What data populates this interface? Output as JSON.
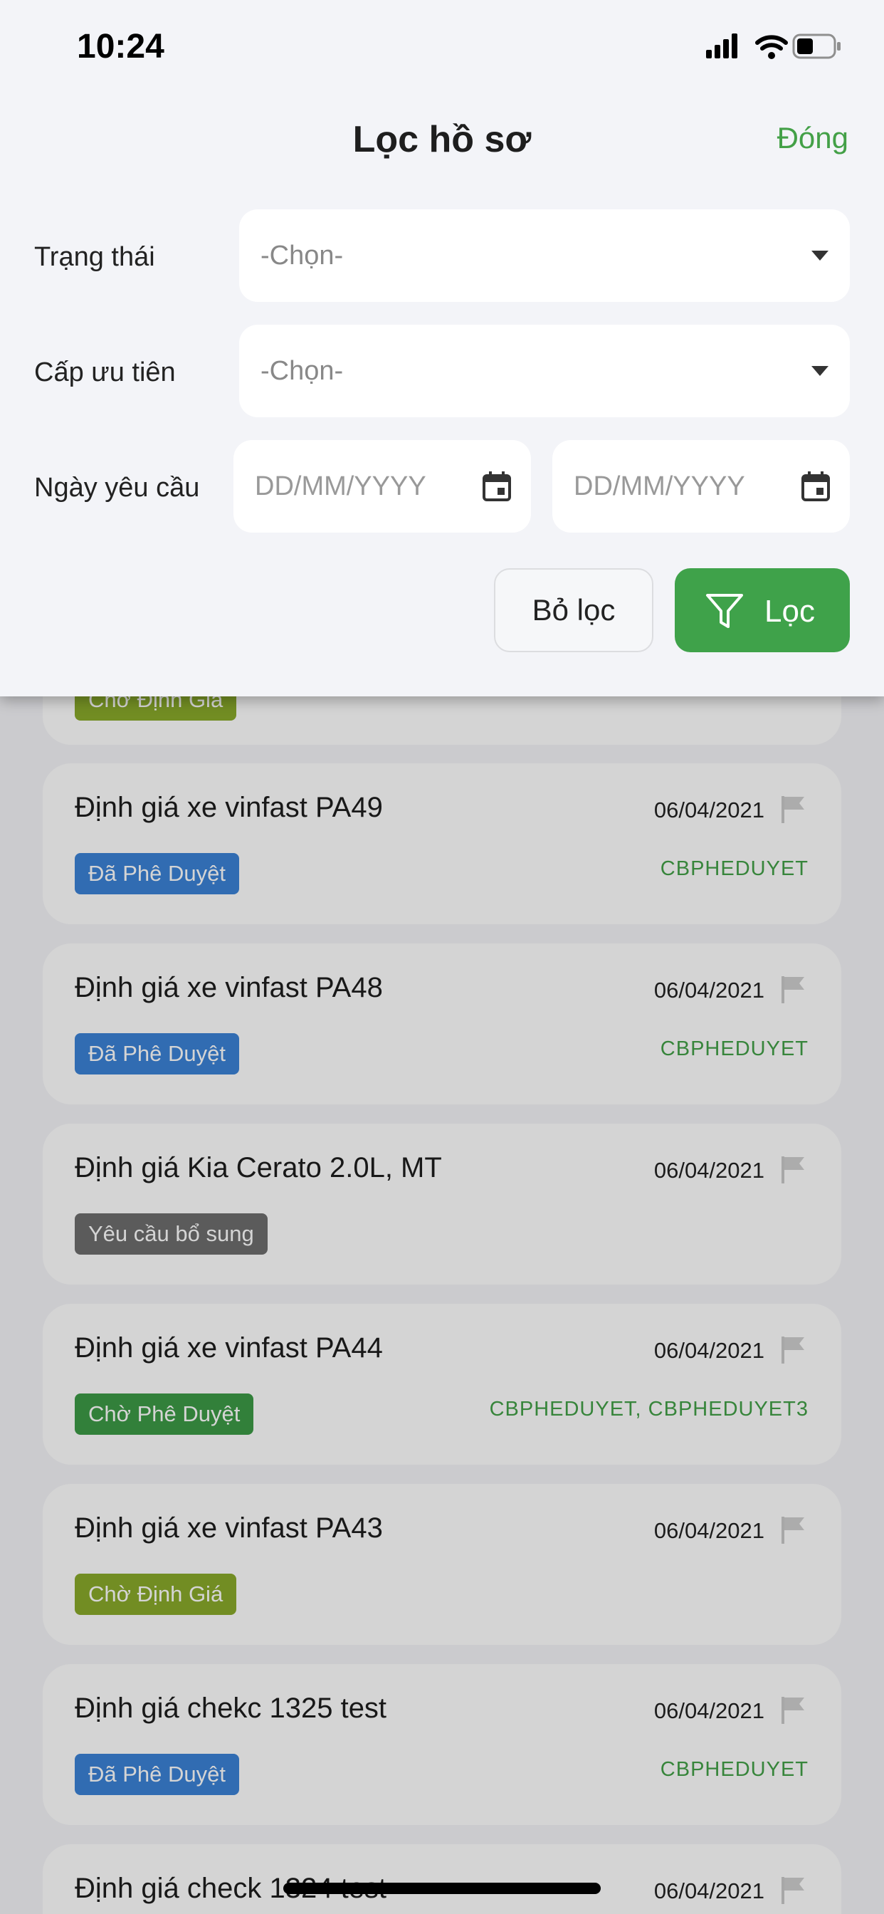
{
  "status_bar": {
    "time": "10:24"
  },
  "filter": {
    "title": "Lọc hồ sơ",
    "close_label": "Đóng",
    "status": {
      "label": "Trạng thái",
      "value": "-Chọn-"
    },
    "priority": {
      "label": "Cấp ưu tiên",
      "value": "-Chọn-"
    },
    "request_date": {
      "label": "Ngày yêu cầu",
      "from_placeholder": "DD/MM/YYYY",
      "to_placeholder": "DD/MM/YYYY"
    },
    "clear_label": "Bỏ lọc",
    "apply_label": "Lọc"
  },
  "list": {
    "partial_badge": "Chờ Định Giá",
    "items": [
      {
        "title": "Định giá xe vinfast PA49",
        "date": "06/04/2021",
        "badge": "Đã Phê Duyệt",
        "approver": "CBPHEDUYET"
      },
      {
        "title": "Định giá xe vinfast PA48",
        "date": "06/04/2021",
        "badge": "Đã Phê Duyệt",
        "approver": "CBPHEDUYET"
      },
      {
        "title": "Định giá Kia Cerato 2.0L, MT",
        "date": "06/04/2021",
        "badge": "Yêu cầu bổ sung",
        "approver": ""
      },
      {
        "title": "Định giá xe vinfast PA44",
        "date": "06/04/2021",
        "badge": "Chờ Phê Duyệt",
        "approver": "CBPHEDUYET, CBPHEDUYET3"
      },
      {
        "title": "Định giá xe vinfast PA43",
        "date": "06/04/2021",
        "badge": "Chờ Định Giá",
        "approver": ""
      },
      {
        "title": "Định giá chekc 1325 test",
        "date": "06/04/2021",
        "badge": "Đã Phê Duyệt",
        "approver": "CBPHEDUYET"
      },
      {
        "title": "Định giá check 1324 test",
        "date": "06/04/2021",
        "badge": "",
        "approver": ""
      }
    ]
  },
  "colors": {
    "accent_green": "#43a047",
    "badge_approved": "#3b82d6",
    "badge_supplement": "#6e6e6e",
    "badge_pending_approval": "#3d9b46",
    "badge_pending_valuation": "#8aaa2b"
  }
}
